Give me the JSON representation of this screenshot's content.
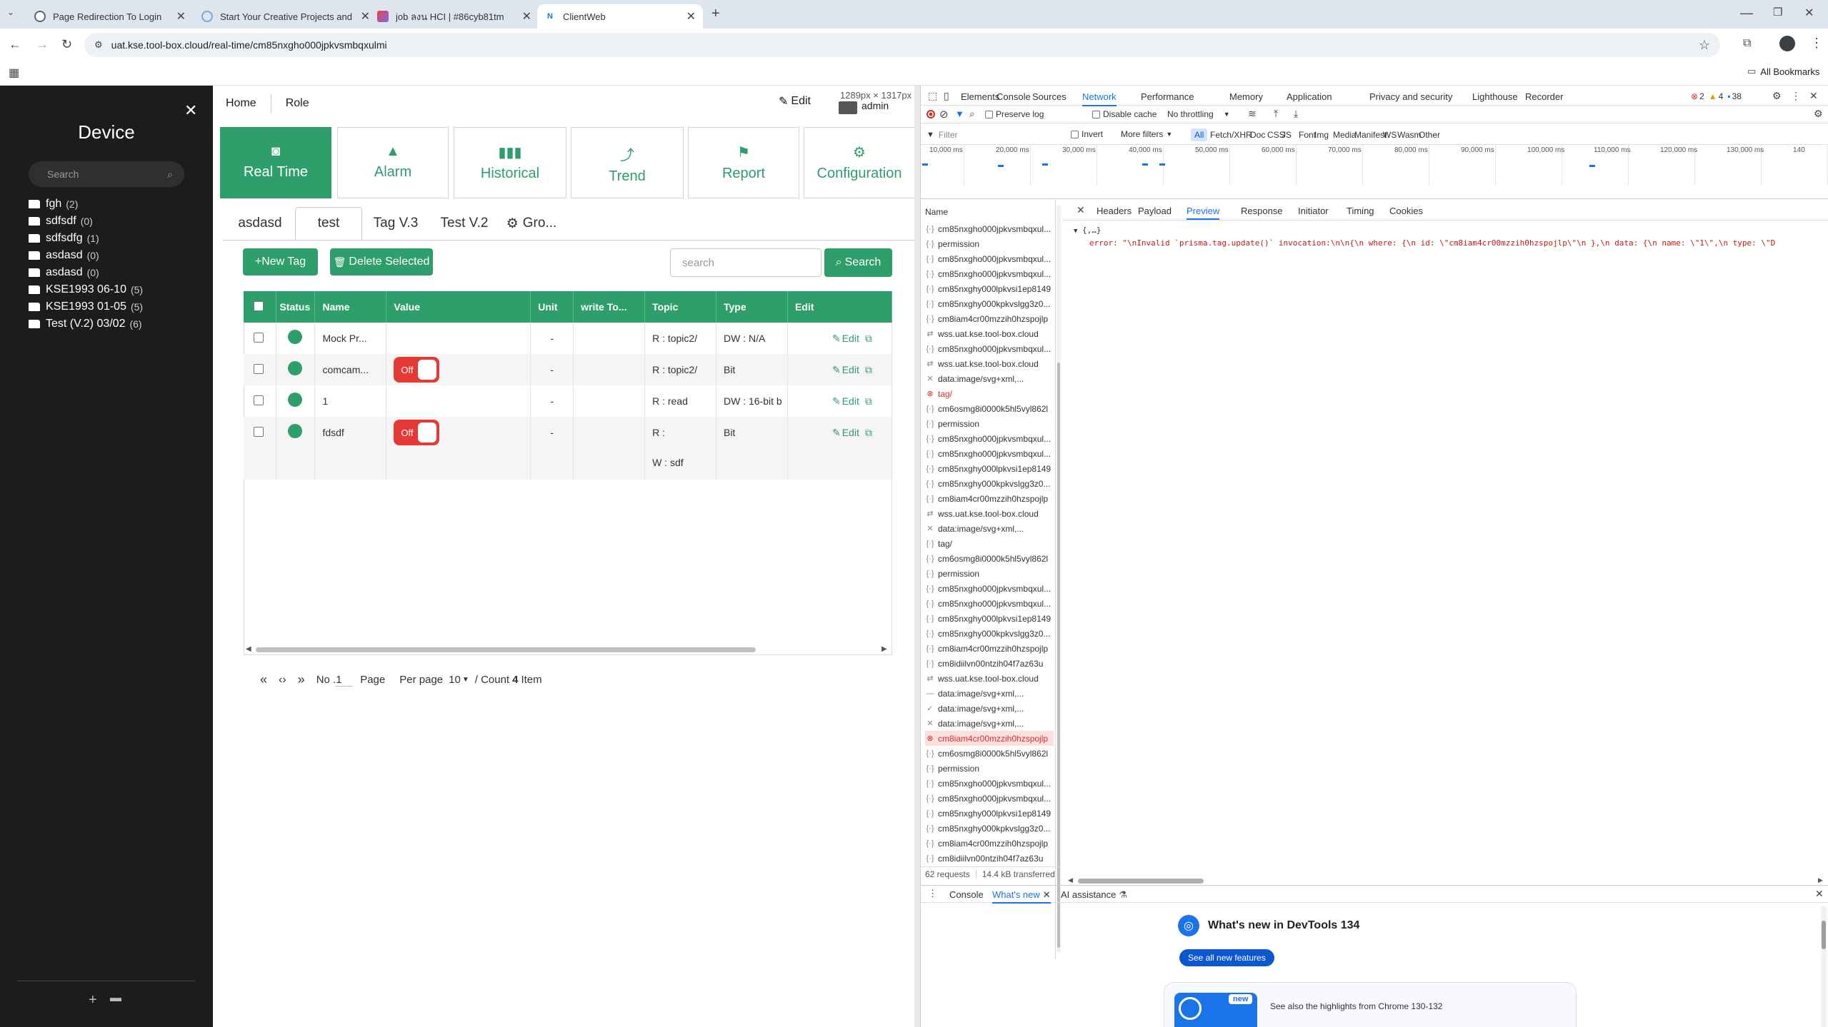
{
  "browser": {
    "tabs": [
      {
        "title": "Page Redirection To Login",
        "favicon_color": "#5f6368"
      },
      {
        "title": "Start Your Creative Projects and",
        "favicon_color": "#7aa7d8"
      },
      {
        "title": "job ลงน HCI | #86cyb81tm",
        "favicon_color": "#e8453c"
      },
      {
        "title": "ClientWeb",
        "favicon_color": "#1a73e8"
      }
    ],
    "url": "uat.kse.tool-box.cloud/real-time/cm85nxgho000jpkvsmbqxulmi",
    "all_bookmarks": "All Bookmarks"
  },
  "sidebar": {
    "title": "Device",
    "search_placeholder": "Search",
    "folders": [
      {
        "name": "fgh",
        "count": "(2)"
      },
      {
        "name": "sdfsdf",
        "count": "(0)"
      },
      {
        "name": "sdfsdfg",
        "count": "(1)"
      },
      {
        "name": "asdasd",
        "count": "(0)"
      },
      {
        "name": "asdasd",
        "count": "(0)"
      },
      {
        "name": "KSE1993 06-10",
        "count": "(5)"
      },
      {
        "name": "KSE1993 01-05",
        "count": "(5)"
      },
      {
        "name": "Test (V.2) 03/02",
        "count": "(6)"
      }
    ]
  },
  "header": {
    "home": "Home",
    "role": "Role",
    "edit": "Edit",
    "dims": "1289px × 1317px",
    "user": "admin"
  },
  "nav": [
    {
      "label": "Real Time",
      "icon": "camera-icon"
    },
    {
      "label": "Alarm",
      "icon": "warning-icon"
    },
    {
      "label": "Historical",
      "icon": "bar-chart-icon"
    },
    {
      "label": "Trend",
      "icon": "trend-icon"
    },
    {
      "label": "Report",
      "icon": "flag-icon"
    },
    {
      "label": "Configuration",
      "icon": "gear-icon"
    }
  ],
  "subtabs": [
    "asdasd",
    "test",
    "Tag V.3",
    "Test V.2",
    "Gro..."
  ],
  "toolbar": {
    "new_tag": "+New Tag",
    "delete_selected": "Delete Selected",
    "search_placeholder": "search",
    "search_button": "Search"
  },
  "table": {
    "headers": [
      "Status",
      "Name",
      "Value",
      "Unit",
      "write To...",
      "Topic",
      "Type",
      "Edit"
    ],
    "rows": [
      {
        "name": "Mock Pr...",
        "value": "",
        "unit": "-",
        "topic": "R : topic2/",
        "topic2": "",
        "type": "DW : N/A",
        "edit": "Edit"
      },
      {
        "name": "comcam...",
        "value": "Off",
        "unit": "-",
        "topic": "R : topic2/",
        "topic2": "",
        "type": "Bit",
        "edit": "Edit"
      },
      {
        "name": "1",
        "value": "",
        "unit": "-",
        "topic": "R : read",
        "topic2": "",
        "type": "DW : 16-bit b",
        "edit": "Edit"
      },
      {
        "name": "fdsdf",
        "value": "Off",
        "unit": "-",
        "topic": "R :",
        "topic2": "W : sdf",
        "type": "Bit",
        "edit": "Edit"
      }
    ]
  },
  "pagination": {
    "no_label": "No .",
    "page_value": "1",
    "page_label": "Page",
    "per_page_label": "Per page",
    "per_page_value": "10",
    "count_prefix": "/ Count",
    "count_value": "4",
    "count_suffix": "Item"
  },
  "devtools": {
    "tabs": [
      "Elements",
      "Console",
      "Sources",
      "Network",
      "Performance",
      "Memory",
      "Application",
      "Privacy and security",
      "Lighthouse",
      "Recorder"
    ],
    "errors": "2",
    "warnings": "4",
    "messages": "38",
    "preserve_log": "Preserve log",
    "disable_cache": "Disable cache",
    "throttling": "No throttling",
    "filter_placeholder": "Filter",
    "invert": "Invert",
    "more_filters": "More filters",
    "filter_types": [
      "All",
      "Fetch/XHR",
      "Doc",
      "CSS",
      "JS",
      "Font",
      "Img",
      "Media",
      "Manifest",
      "WS",
      "Wasm",
      "Other"
    ],
    "timeline_ticks": [
      "10,000 ms",
      "20,000 ms",
      "30,000 ms",
      "40,000 ms",
      "50,000 ms",
      "60,000 ms",
      "70,000 ms",
      "80,000 ms",
      "90,000 ms",
      "100,000 ms",
      "110,000 ms",
      "120,000 ms",
      "130,000 ms",
      "140"
    ],
    "name_header": "Name",
    "detail_tabs": [
      "Headers",
      "Payload",
      "Preview",
      "Response",
      "Initiator",
      "Timing",
      "Cookies"
    ],
    "preview_root": "{,…}",
    "preview_error": "error: \"\\nInvalid `prisma.tag.update()` invocation:\\n\\n{\\n  where: {\\n    id: \\\"cm8iam4cr00mzzih0hzspojlp\\\"\\n  },\\n  data: {\\n    name: \\\"1\\\",\\n    type: \\\"D",
    "requests": [
      {
        "name": "cm85nxgho000jpkvsmbqxul...",
        "kind": "fetch"
      },
      {
        "name": "permission",
        "kind": "fetch"
      },
      {
        "name": "cm85nxgho000jpkvsmbqxul...",
        "kind": "fetch"
      },
      {
        "name": "cm85nxgho000jpkvsmbqxul...",
        "kind": "fetch"
      },
      {
        "name": "cm85nxghy000lpkvsi1ep8149",
        "kind": "fetch"
      },
      {
        "name": "cm85nxghy000kpkvslgg3z0...",
        "kind": "fetch"
      },
      {
        "name": "cm8iam4cr00mzzih0hzspojlp",
        "kind": "fetch"
      },
      {
        "name": "wss.uat.kse.tool-box.cloud",
        "kind": "ws"
      },
      {
        "name": "cm85nxgho000jpkvsmbqxul...",
        "kind": "fetch"
      },
      {
        "name": "wss.uat.kse.tool-box.cloud",
        "kind": "ws"
      },
      {
        "name": "data:image/svg+xml,...",
        "kind": "x"
      },
      {
        "name": "tag/",
        "kind": "error"
      },
      {
        "name": "cm6osmg8i0000k5hl5vyl862l",
        "kind": "fetch"
      },
      {
        "name": "permission",
        "kind": "fetch"
      },
      {
        "name": "cm85nxgho000jpkvsmbqxul...",
        "kind": "fetch"
      },
      {
        "name": "cm85nxgho000jpkvsmbqxul...",
        "kind": "fetch"
      },
      {
        "name": "cm85nxghy000lpkvsi1ep8149",
        "kind": "fetch"
      },
      {
        "name": "cm85nxghy000kpkvslgg3z0...",
        "kind": "fetch"
      },
      {
        "name": "cm8iam4cr00mzzih0hzspojlp",
        "kind": "fetch"
      },
      {
        "name": "wss.uat.kse.tool-box.cloud",
        "kind": "ws"
      },
      {
        "name": "data:image/svg+xml,...",
        "kind": "x"
      },
      {
        "name": "tag/",
        "kind": "fetch"
      },
      {
        "name": "cm6osmg8i0000k5hl5vyl862l",
        "kind": "fetch"
      },
      {
        "name": "permission",
        "kind": "fetch"
      },
      {
        "name": "cm85nxgho000jpkvsmbqxul...",
        "kind": "fetch"
      },
      {
        "name": "cm85nxgho000jpkvsmbqxul...",
        "kind": "fetch"
      },
      {
        "name": "cm85nxghy000lpkvsi1ep8149",
        "kind": "fetch"
      },
      {
        "name": "cm85nxghy000kpkvslgg3z0...",
        "kind": "fetch"
      },
      {
        "name": "cm8iam4cr00mzzih0hzspojlp",
        "kind": "fetch"
      },
      {
        "name": "cm8idiilvn00ntzih04f7az63u",
        "kind": "fetch"
      },
      {
        "name": "wss.uat.kse.tool-box.cloud",
        "kind": "ws"
      },
      {
        "name": "data:image/svg+xml,...",
        "kind": "dash"
      },
      {
        "name": "data:image/svg+xml,...",
        "kind": "check"
      },
      {
        "name": "data:image/svg+xml,...",
        "kind": "x"
      },
      {
        "name": "cm8iam4cr00mzzih0hzspojlp",
        "kind": "error-selected"
      },
      {
        "name": "cm6osmg8i0000k5hl5vyl862l",
        "kind": "fetch"
      },
      {
        "name": "permission",
        "kind": "fetch"
      },
      {
        "name": "cm85nxgho000jpkvsmbqxul...",
        "kind": "fetch"
      },
      {
        "name": "cm85nxgho000jpkvsmbqxul...",
        "kind": "fetch"
      },
      {
        "name": "cm85nxghy000lpkvsi1ep8149",
        "kind": "fetch"
      },
      {
        "name": "cm85nxghy000kpkvslgg3z0...",
        "kind": "fetch"
      },
      {
        "name": "cm8iam4cr00mzzih0hzspojlp",
        "kind": "fetch"
      },
      {
        "name": "cm8idiilvn00ntzih04f7az63u",
        "kind": "fetch"
      }
    ],
    "summary_requests": "62 requests",
    "summary_transferred": "14.4 kB transferred",
    "drawer_tabs": [
      "Console",
      "What's new",
      "AI assistance"
    ],
    "whats_new_title": "What's new in DevTools 134",
    "see_all": "See all new features",
    "new_badge": "new",
    "highlights": "See also the highlights from Chrome 130-132"
  }
}
